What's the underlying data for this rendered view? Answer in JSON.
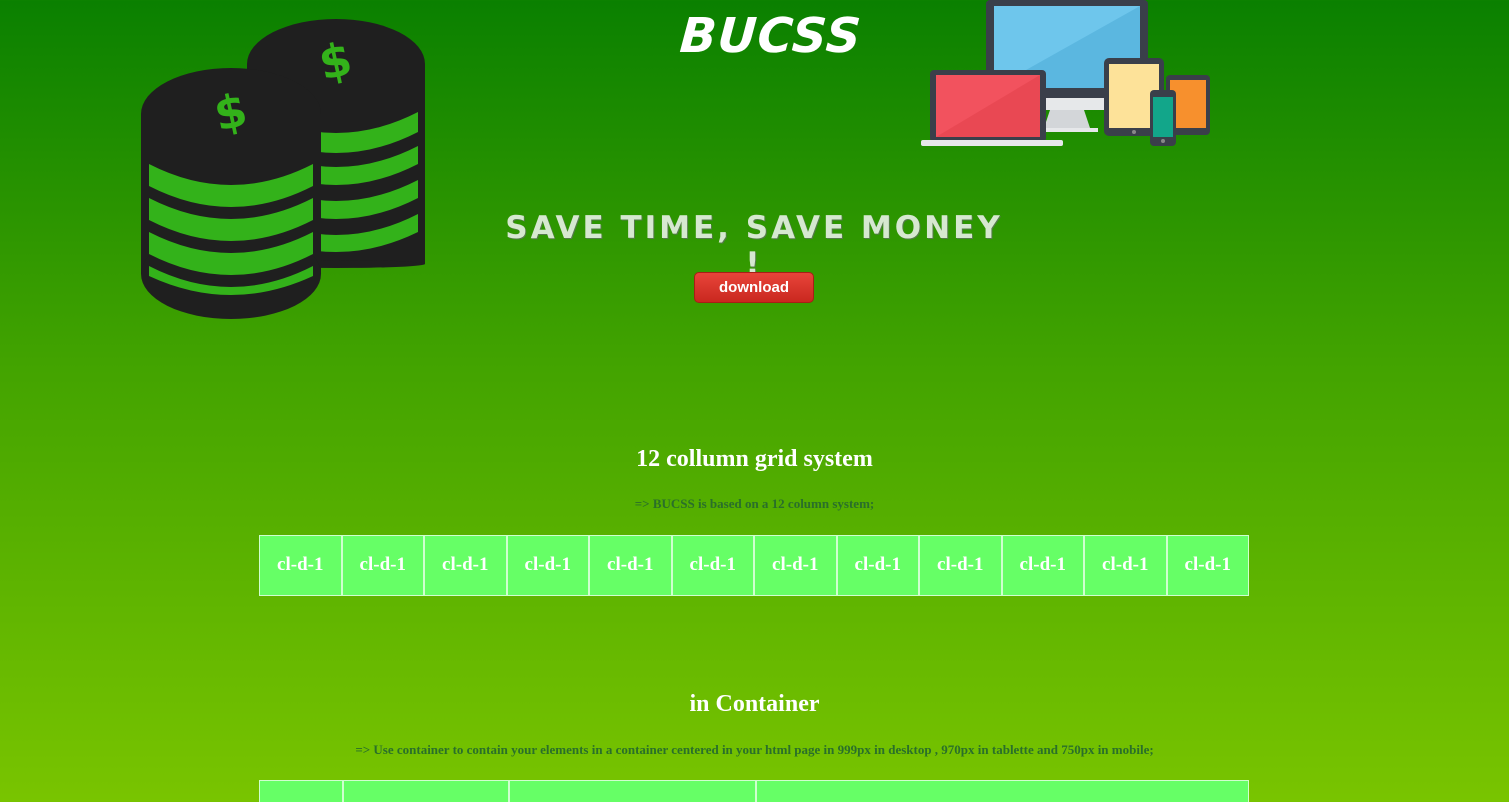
{
  "header": {
    "brand": "BUCSS",
    "slogan": "SAVE TIME, SAVE MONEY !",
    "download_label": "download",
    "coins_icon": "coins-stack-icon",
    "devices_icon": "responsive-devices-icon"
  },
  "grid_section": {
    "title": "12 collumn grid system",
    "description": "=> BUCSS is based on a 12 column system;",
    "cells": [
      "cl-d-1",
      "cl-d-1",
      "cl-d-1",
      "cl-d-1",
      "cl-d-1",
      "cl-d-1",
      "cl-d-1",
      "cl-d-1",
      "cl-d-1",
      "cl-d-1",
      "cl-d-1",
      "cl-d-1"
    ]
  },
  "container_section": {
    "title": "in Container",
    "description": "=> Use container to contain your elements in a container centered in your html page in 999px in desktop , 970px in tablette and 750px in mobile;"
  },
  "colors": {
    "background_top": "#0a8000",
    "background_bottom": "#79c400",
    "cell_fill": "#66ff66",
    "button": "#d9332a",
    "description_text": "#2a6f2a"
  }
}
